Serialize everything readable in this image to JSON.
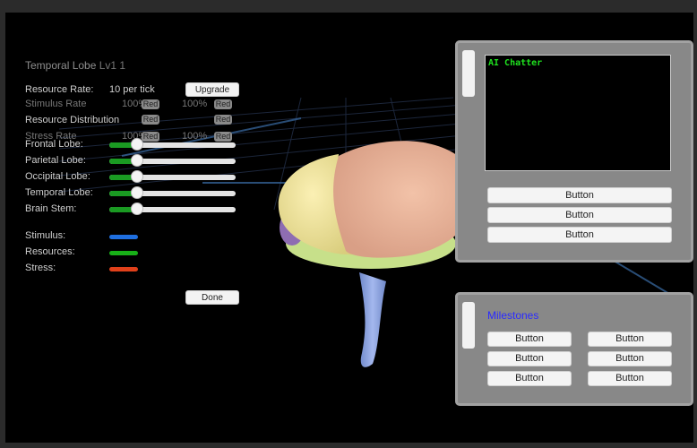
{
  "lobe_panel": {
    "title_text": "Temporal Lobe",
    "title_overlap": "Lv1 1",
    "resource_rate_label": "Resource Rate:",
    "resource_rate_value": "10 per tick",
    "upgrade_label": "Upgrade",
    "ghost_stimulus_rate": "Stimulus Rate",
    "ghost_percent": "100%",
    "mini_red": "Red",
    "ghost_stress_rate": "Stress Rate",
    "resource_distribution_label": "Resource Distribution",
    "sliders": [
      {
        "label": "Frontal Lobe:",
        "value": 0.22
      },
      {
        "label": "Parietal Lobe:",
        "value": 0.22
      },
      {
        "label": "Occipital Lobe:",
        "value": 0.22
      },
      {
        "label": "Temporal Lobe:",
        "value": 0.22
      },
      {
        "label": "Brain Stem:",
        "value": 0.22
      }
    ],
    "legend": [
      {
        "label": "Stimulus:",
        "color": "#1f6fe0"
      },
      {
        "label": "Resources:",
        "color": "#18b018"
      },
      {
        "label": "Stress:",
        "color": "#e0401a"
      }
    ],
    "done_label": "Done"
  },
  "chat_panel": {
    "title": "AI Chatter",
    "buttons": [
      "Button",
      "Button",
      "Button"
    ]
  },
  "milestones_panel": {
    "title": "Milestones",
    "buttons": [
      "Button",
      "Button",
      "Button",
      "Button",
      "Button",
      "Button"
    ]
  },
  "colors": {
    "slider_fill": "#1a9a22",
    "panel_bg": "#888888",
    "chat_text": "#1fe21f",
    "milestones_text": "#2b2bff"
  }
}
